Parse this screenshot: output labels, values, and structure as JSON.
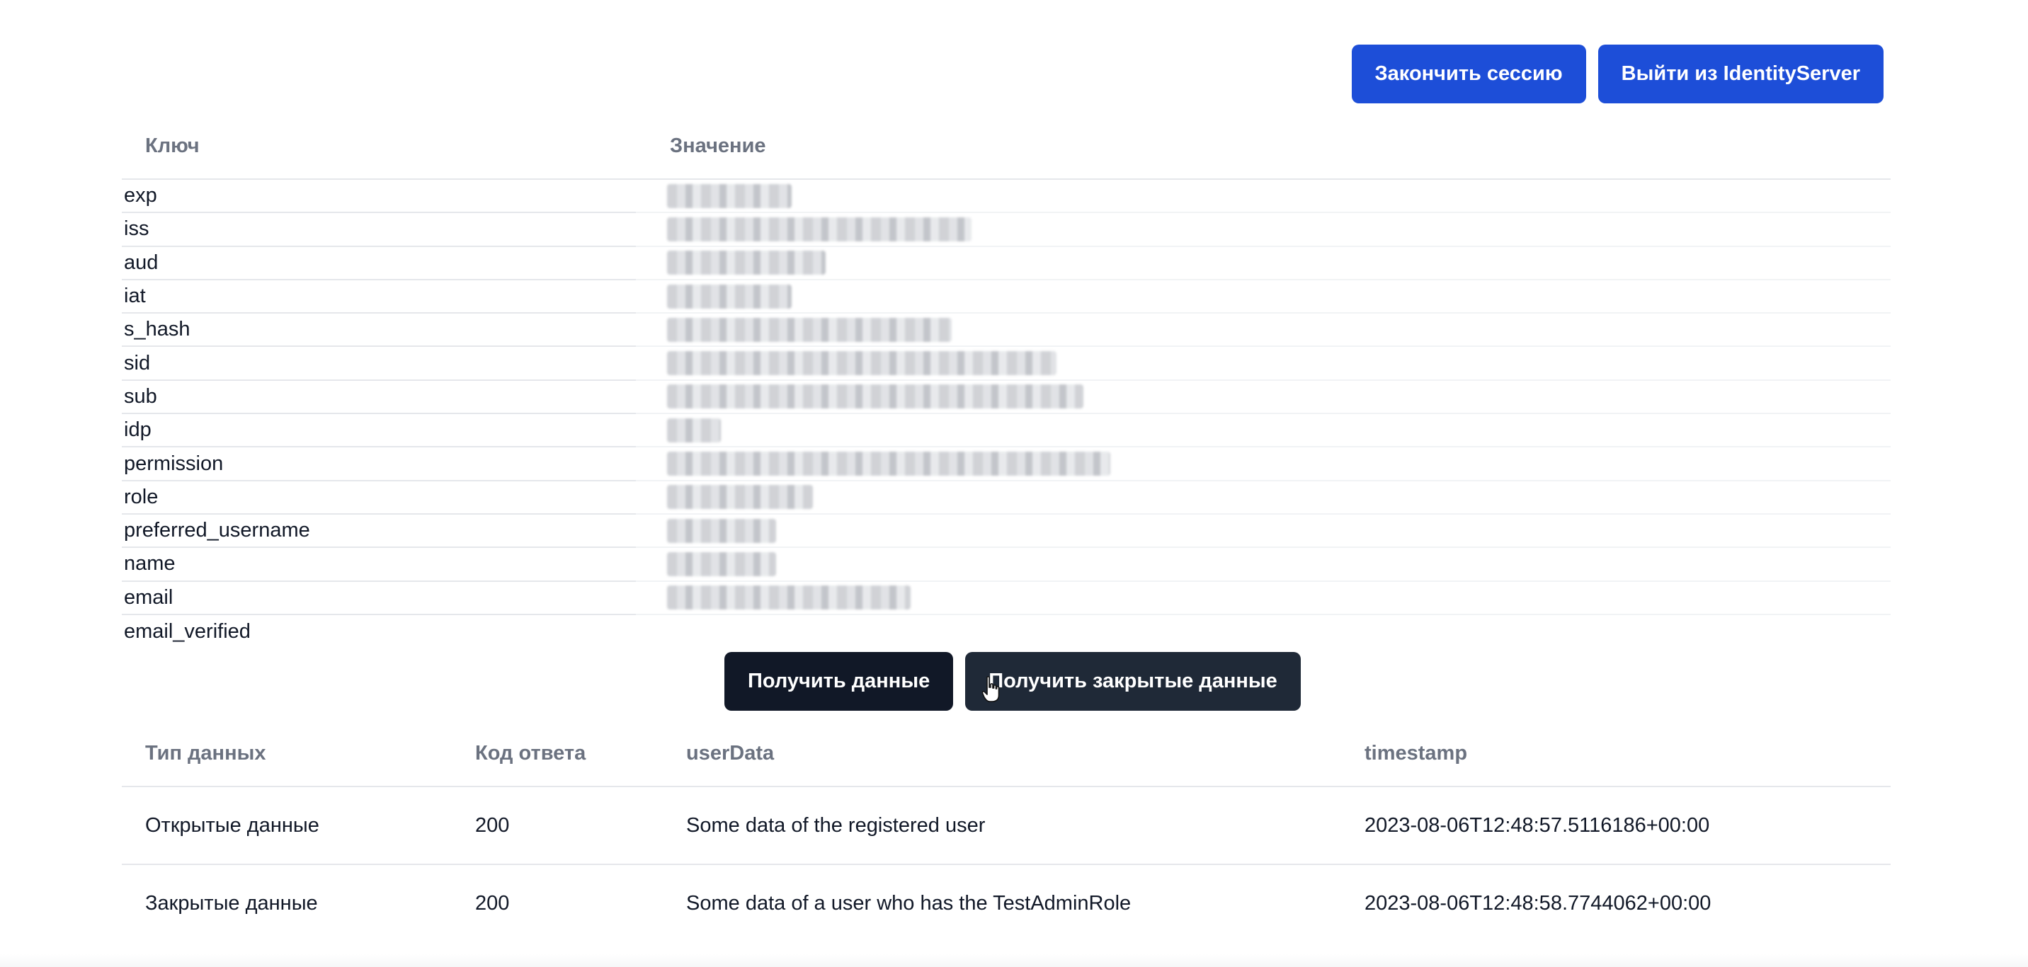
{
  "top_actions": {
    "end_session": "Закончить сессию",
    "logout_identity": "Выйти из IdentityServer"
  },
  "claims": {
    "header_key": "Ключ",
    "header_value": "Значение",
    "rows": [
      {
        "key": "exp"
      },
      {
        "key": "iss"
      },
      {
        "key": "aud"
      },
      {
        "key": "iat"
      },
      {
        "key": "s_hash"
      },
      {
        "key": "sid"
      },
      {
        "key": "sub"
      },
      {
        "key": "idp"
      },
      {
        "key": "permission"
      },
      {
        "key": "role"
      },
      {
        "key": "preferred_username"
      },
      {
        "key": "name"
      },
      {
        "key": "email"
      },
      {
        "key": "email_verified"
      }
    ]
  },
  "mid_actions": {
    "get_data": "Получить данные",
    "get_private_data": "Получить закрытые данные"
  },
  "results": {
    "headers": [
      "Тип данных",
      "Код ответа",
      "userData",
      "timestamp"
    ],
    "rows": [
      [
        "Открытые данные",
        "200",
        "Some data of the registered user",
        "2023-08-06T12:48:57.5116186+00:00"
      ],
      [
        "Закрытые данные",
        "200",
        "Some data of a user who has the TestAdminRole",
        "2023-08-06T12:48:58.7744062+00:00"
      ]
    ]
  },
  "colors": {
    "primary_blue": "#1d4ed8",
    "dark_button": "#111827",
    "header_text": "#6b7280"
  }
}
